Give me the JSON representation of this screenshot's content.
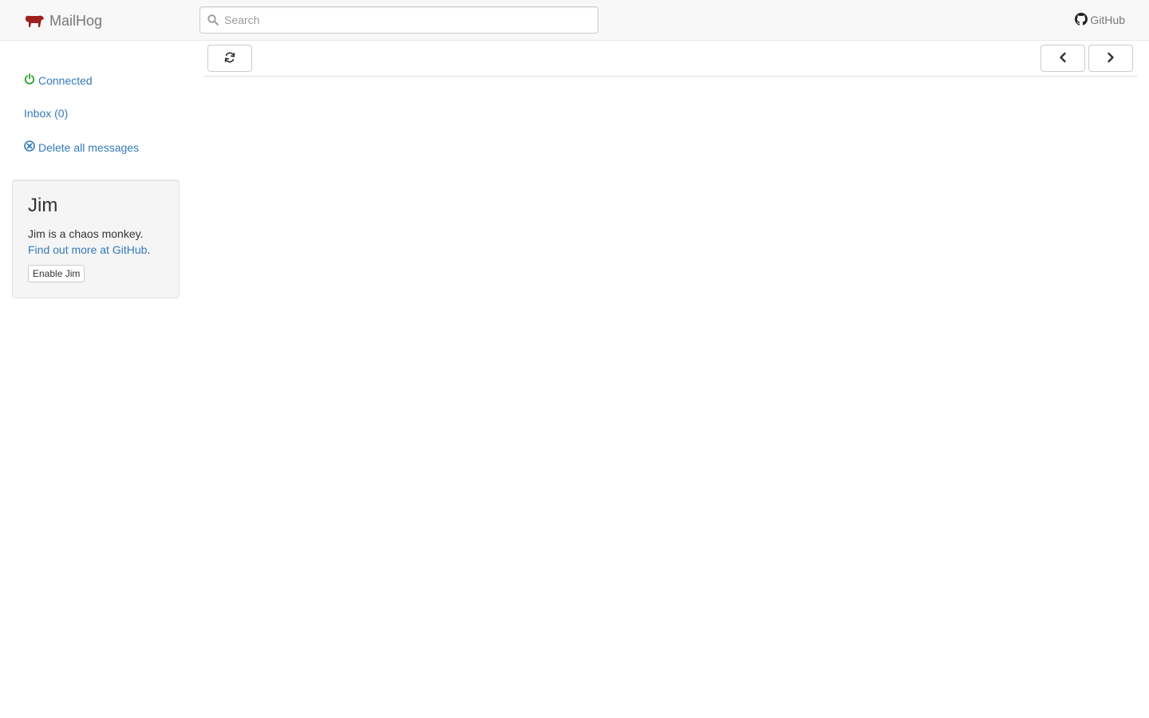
{
  "app": {
    "brand": "MailHog",
    "brand_color": "#9e2121",
    "link_color": "#337ab7",
    "connected_color": "#2ba02b"
  },
  "navbar": {
    "search": {
      "placeholder": "Search",
      "value": "",
      "icon": "search-icon"
    },
    "github_label": "GitHub"
  },
  "sidebar": {
    "status_label": "Connected",
    "inbox_label": "Inbox (0)",
    "delete_label": "Delete all messages"
  },
  "jim": {
    "title": "Jim",
    "description": "Jim is a chaos monkey.",
    "link_text": "Find out more at GitHub",
    "link_suffix": ".",
    "button_label": "Enable Jim"
  },
  "toolbar": {
    "refresh_icon": "refresh-icon",
    "prev_icon": "chevron-left-icon",
    "next_icon": "chevron-right-icon"
  }
}
